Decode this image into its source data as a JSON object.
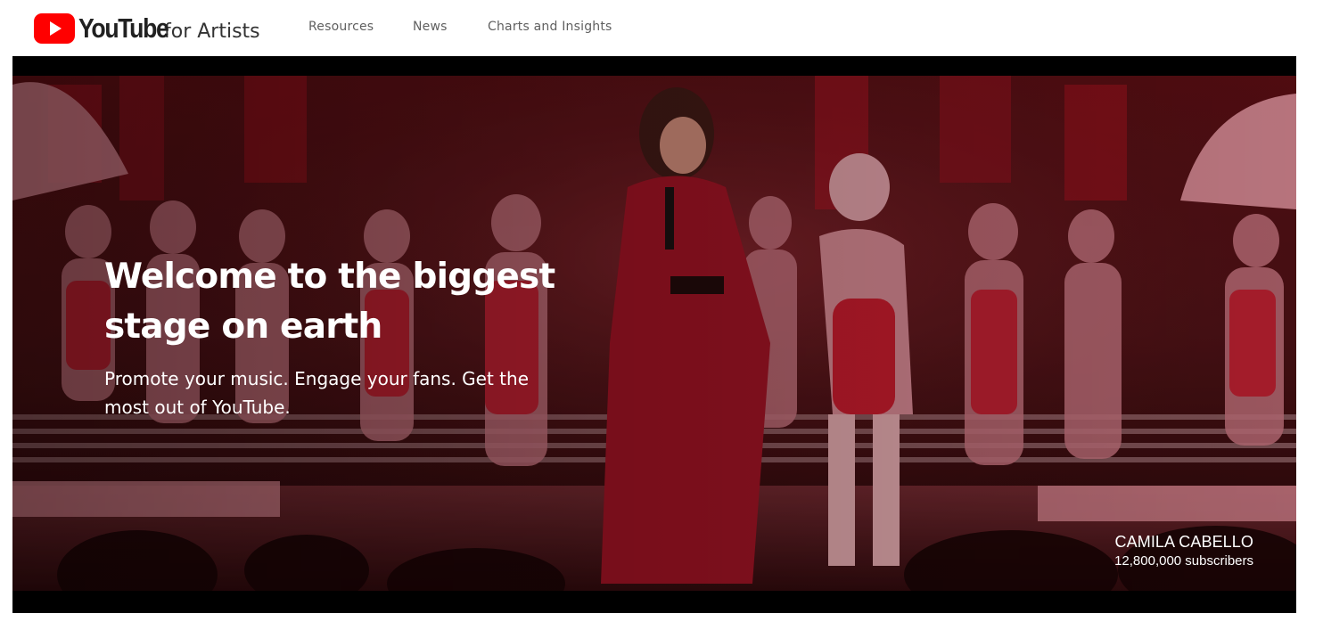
{
  "brand": {
    "wordmark": "YouTube",
    "suffix": "for Artists",
    "accent_color": "#ff0000"
  },
  "nav": {
    "items": [
      {
        "label": "Resources"
      },
      {
        "label": "News"
      },
      {
        "label": "Charts and Insights"
      }
    ]
  },
  "hero": {
    "title": "Welcome to the biggest stage on earth",
    "subtitle": "Promote your music. Engage your fans. Get the most out of YouTube.",
    "credit": {
      "artist": "CAMILA CABELLO",
      "subscribers": "12,800,000 subscribers"
    },
    "background_colors": {
      "base": "#3a0d10",
      "stage_red": "#b3192a",
      "pink": "#d98a96"
    }
  }
}
